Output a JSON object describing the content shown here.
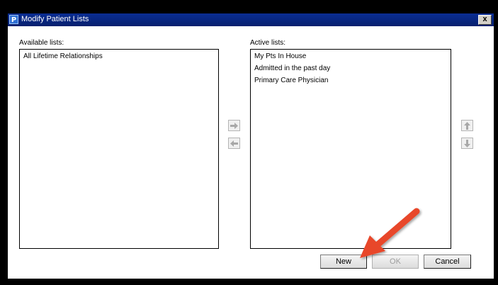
{
  "window": {
    "title": "Modify Patient Lists",
    "app_icon_letter": "P",
    "close_label": "x"
  },
  "available": {
    "label": "Available lists:",
    "items": [
      "All Lifetime Relationships"
    ]
  },
  "active": {
    "label": "Active lists:",
    "items": [
      "My Pts In House",
      "Admitted in the past day",
      "Primary Care Physician"
    ]
  },
  "buttons": {
    "new": "New",
    "ok": "OK",
    "cancel": "Cancel"
  },
  "colors": {
    "titlebar": "#0a2d93",
    "annotation_arrow": "#e8472a"
  },
  "icons": {
    "move_right": "arrow-right-icon",
    "move_left": "arrow-left-icon",
    "move_up": "arrow-up-icon",
    "move_down": "arrow-down-icon"
  }
}
